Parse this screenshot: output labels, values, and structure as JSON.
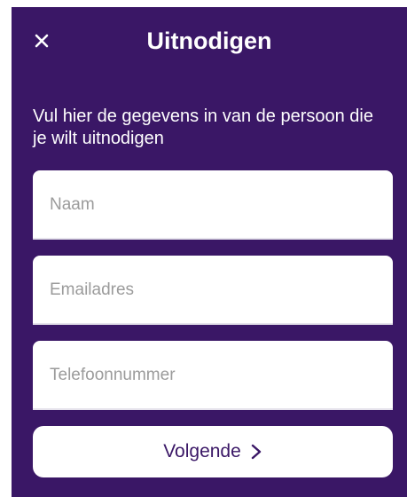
{
  "header": {
    "title": "Uitnodigen",
    "close_icon": "close-icon"
  },
  "intro": {
    "text": "Vul hier de gegevens in van de persoon die je wilt uitnodigen"
  },
  "form": {
    "name_placeholder": "Naam",
    "name_value": "",
    "email_placeholder": "Emailadres",
    "email_value": "",
    "phone_placeholder": "Telefoonnummer",
    "phone_value": ""
  },
  "next_button": {
    "label": "Volgende",
    "icon": "chevron-right-icon"
  },
  "colors": {
    "background": "#3a1766",
    "field_background": "#ffffff",
    "placeholder": "#9b9b9b",
    "accent_text": "#3a1766"
  }
}
